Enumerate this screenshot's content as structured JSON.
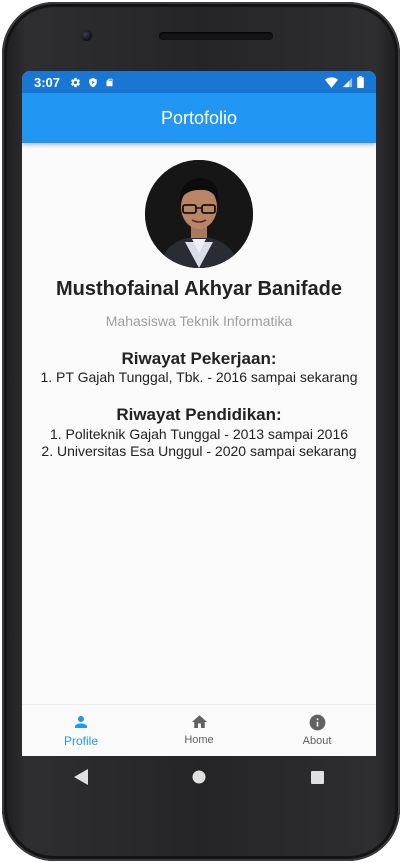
{
  "status_bar": {
    "time": "3:07"
  },
  "app_bar": {
    "title": "Portofolio"
  },
  "profile": {
    "name": "Musthofainal Akhyar Banifade",
    "subtitle": "Mahasiswa Teknik Informatika"
  },
  "work_history": {
    "title": "Riwayat Pekerjaan:",
    "items": [
      "1. PT Gajah Tunggal, Tbk. - 2016 sampai sekarang"
    ]
  },
  "education_history": {
    "title": "Riwayat Pendidikan:",
    "items": [
      "1. Politeknik Gajah Tunggal - 2013 sampai 2016",
      "2. Universitas Esa Unggul - 2020 sampai sekarang"
    ]
  },
  "bottom_nav": {
    "items": [
      {
        "label": "Profile",
        "icon": "person-icon",
        "active": true
      },
      {
        "label": "Home",
        "icon": "home-icon",
        "active": false
      },
      {
        "label": "About",
        "icon": "info-icon",
        "active": false
      }
    ]
  },
  "colors": {
    "primary": "#2196f3",
    "status_bar": "#1976d2",
    "background": "#fafafa",
    "subtitle": "#9e9e9e"
  }
}
